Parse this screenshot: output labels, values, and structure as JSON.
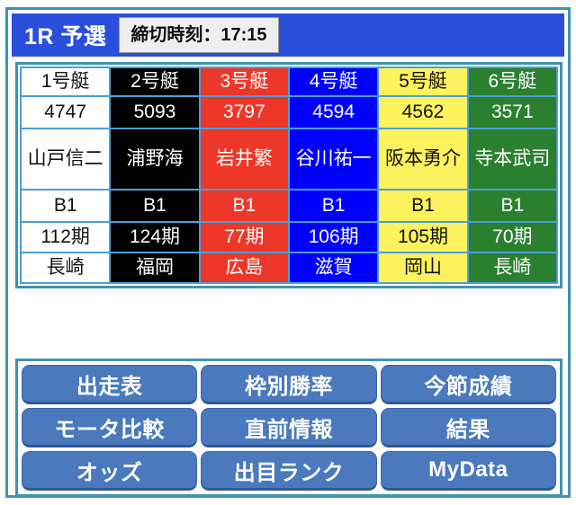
{
  "header": {
    "race_title": "1R 予選",
    "deadline_label": "締切時刻：17:15",
    "bar_color": "#2a4fdb"
  },
  "racer_table": {
    "row_keys": [
      "lane",
      "reg_no",
      "name",
      "grade",
      "period",
      "branch"
    ],
    "lanes": [
      {
        "lane": "1号艇",
        "reg_no": "4747",
        "name": "山戸信二",
        "grade": "B1",
        "period": "112期",
        "branch": "長崎",
        "bg_color": "#ffffff",
        "text_color": "#111111"
      },
      {
        "lane": "2号艇",
        "reg_no": "5093",
        "name": "浦野海",
        "grade": "B1",
        "period": "124期",
        "branch": "福岡",
        "bg_color": "#000000",
        "text_color": "#ffffff"
      },
      {
        "lane": "3号艇",
        "reg_no": "3797",
        "name": "岩井繁",
        "grade": "B1",
        "period": "77期",
        "branch": "広島",
        "bg_color": "#ed3728",
        "text_color": "#ffffff"
      },
      {
        "lane": "4号艇",
        "reg_no": "4594",
        "name": "谷川祐一",
        "grade": "B1",
        "period": "106期",
        "branch": "滋賀",
        "bg_color": "#0000ff",
        "text_color": "#ffffff"
      },
      {
        "lane": "5号艇",
        "reg_no": "4562",
        "name": "阪本勇介",
        "grade": "B1",
        "period": "105期",
        "branch": "岡山",
        "bg_color": "#fbf25e",
        "text_color": "#111111"
      },
      {
        "lane": "6号艇",
        "reg_no": "3571",
        "name": "寺本武司",
        "grade": "B1",
        "period": "70期",
        "branch": "長崎",
        "bg_color": "#2b8030",
        "text_color": "#ffffff"
      }
    ]
  },
  "nav_buttons": [
    {
      "label": "出走表"
    },
    {
      "label": "枠別勝率"
    },
    {
      "label": "今節成績"
    },
    {
      "label": "モータ比較"
    },
    {
      "label": "直前情報"
    },
    {
      "label": "結果"
    },
    {
      "label": "オッズ"
    },
    {
      "label": "出目ランク"
    },
    {
      "label": "MyData"
    }
  ],
  "theme": {
    "frame_color": "#3f94b0",
    "cell_border_color": "#4a9fd8",
    "button_color": "#4a79bd",
    "button_shadow_color": "#2f5893",
    "page_background": "#ffffff"
  }
}
